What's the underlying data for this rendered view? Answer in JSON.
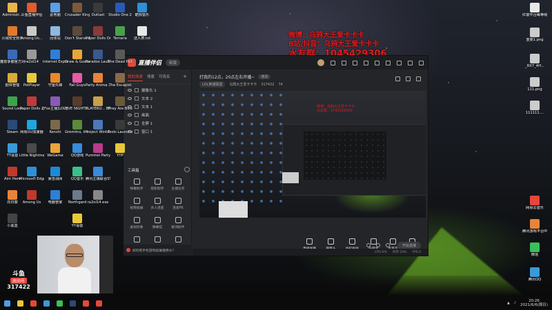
{
  "desktop": {
    "left_icons": [
      {
        "label": "Administr...",
        "color": "#e8b74a"
      },
      {
        "label": "斗鱼直播伴侣",
        "color": "#e25b2b"
      },
      {
        "label": "此电脑",
        "color": "#5aa0e8"
      },
      {
        "label": "火绒安全软件",
        "color": "#e07a2a"
      },
      {
        "label": "Among.Us...",
        "color": "#c9c9c9"
      },
      {
        "label": "回收站",
        "color": "#8fb8e0"
      },
      {
        "label": "魔兽争霸官方对战平台",
        "color": "#3a6ab8"
      },
      {
        "label": "ra2ol14",
        "color": "#999999"
      },
      {
        "label": "Internet Explorer",
        "color": "#2f7fd6"
      },
      {
        "label": "欧体管理",
        "color": "#d9a93a"
      },
      {
        "label": "PotPlayer",
        "color": "#e8c83a"
      },
      {
        "label": "守望先锋",
        "color": "#e88a2a"
      },
      {
        "label": "Sound Lock",
        "color": "#3fa34a"
      },
      {
        "label": "Paper Dolls 2",
        "color": "#c03a3a"
      },
      {
        "label": "[Fox主播]LOL客户端",
        "color": "#8a5ab8"
      },
      {
        "label": "Steam",
        "color": "#2a4a78"
      },
      {
        "label": "网易UU加速器",
        "color": "#1ea5e0"
      },
      {
        "label": "Kenshi",
        "color": "#7a6a4a"
      },
      {
        "label": "TT语音",
        "color": "#3a9ad8"
      },
      {
        "label": "Little Nightmares",
        "color": "#4a4a4a"
      },
      {
        "label": "WeGame",
        "color": "#e8a53a"
      },
      {
        "label": "Aim Hero",
        "color": "#c0392b"
      },
      {
        "label": "Microsoft Edge",
        "color": "#2f8fd6"
      },
      {
        "label": "暴雪战网",
        "color": "#1c8ad8"
      },
      {
        "label": "向日葵",
        "color": "#e8843a"
      },
      {
        "label": "Among Us",
        "color": "#c0392b"
      },
      {
        "label": "电脑管家",
        "color": "#2f7fd6"
      },
      {
        "label": "小黑盒",
        "color": "#444444"
      }
    ],
    "col3_icons": [
      {
        "label": "Crusader Kings III",
        "color": "#7a5a3a"
      },
      {
        "label": "Don't Starve Together",
        "color": "#5a4a3a"
      },
      {
        "label": "Draw & Guess",
        "color": "#e8a53a"
      },
      {
        "label": "Fall Guys",
        "color": "#e85aa5"
      },
      {
        "label": "FIVE NIGHTS...",
        "color": "#5a3a2a"
      },
      {
        "label": "Gremlins, Inc.",
        "color": "#5a8a3a"
      },
      {
        "label": "QQ游戏",
        "color": "#3a8ad8"
      },
      {
        "label": "QQ音乐",
        "color": "#3ac08a"
      },
      {
        "label": "Northgard",
        "color": "#6a7a8a"
      },
      {
        "label": "YY语音",
        "color": "#e8c83a"
      }
    ],
    "col4_icons": [
      {
        "label": "Outlast",
        "color": "#3a3a3a"
      },
      {
        "label": "Paper Dolls Original",
        "color": "#8a3a3a"
      },
      {
        "label": "Paradox Launcher v2",
        "color": "#3a5a8a"
      },
      {
        "label": "Party Anima...",
        "color": "#e8843a"
      },
      {
        "label": "PLAYERU... BATTLEGR...",
        "color": "#c8a04a"
      },
      {
        "label": "Project Winter",
        "color": "#4a7ab8"
      },
      {
        "label": "Pummel Party",
        "color": "#b83a8a"
      },
      {
        "label": "腾讯主播联合STG",
        "color": "#3a8ad8"
      },
      {
        "label": "ra2ol14.exe",
        "color": "#888888"
      }
    ],
    "col5_icons": [
      {
        "label": "Studio One 2",
        "color": "#2a5ab8"
      },
      {
        "label": "Terraria",
        "color": "#4aa04a"
      },
      {
        "label": "The Dead Picture",
        "color": "#5a5a5a"
      },
      {
        "label": "The Escapist",
        "color": "#8a6a4a"
      },
      {
        "label": "They Are Billions",
        "color": "#6a5a3a"
      },
      {
        "label": "Tools Launcher",
        "color": "#3a3a3a"
      },
      {
        "label": "YYP",
        "color": "#e8c83a"
      }
    ],
    "col6_icons": [
      {
        "label": "酷狗音乐",
        "color": "#2f8fd6"
      },
      {
        "label": "送人表.txt",
        "color": "#e8e8e8"
      }
    ],
    "right_icons": [
      {
        "label": "红警平台每等级别.txt",
        "color": "#e8e8e8"
      },
      {
        "label": "重要1.png",
        "color": "#cccccc"
      },
      {
        "label": "_RX7_4H...",
        "color": "#cccccc"
      },
      {
        "label": "111.png",
        "color": "#cccccc"
      },
      {
        "label": "111111....",
        "color": "#cccccc"
      },
      {
        "label": "网易云音乐",
        "color": "#e8463b"
      },
      {
        "label": "腾讯游戏平台中心",
        "color": "#e8843a"
      },
      {
        "label": "微信",
        "color": "#3ac05a"
      },
      {
        "label": "腾讯QQ",
        "color": "#3a9ad8"
      }
    ]
  },
  "overlay": {
    "line1": "微博：乌鸦大王爱卡卡卡",
    "line2": "B站/抖音：乌鸦大王爱卡卡卡",
    "line3": "水友群：1045429306"
  },
  "app": {
    "brand": "直播伴侣",
    "version": "新版",
    "tabs": [
      "我的场景",
      "场景",
      "可改名"
    ],
    "sources": [
      "摄像头 1",
      "文本 2",
      "文本 1",
      "画面",
      "全屏 1",
      "窗口 1"
    ],
    "tools_title": "工具箱",
    "tools": [
      "弹幕助手",
      "观影助手",
      "主播任务",
      "视频投屏",
      "多人连麦",
      "连麦PK",
      "虚拟形象",
      "弹幕馆",
      "歌词助手",
      "连麦",
      "投票",
      "更多"
    ],
    "headline": "打我的12点，20点左右开播~",
    "headline_tag": "修改",
    "subline": {
      "category": "LOL英雄联盟",
      "owner": "乌鸦大王爱卡卡卡",
      "room_id": "317422",
      "likes": "74"
    },
    "preview_red": "微博：乌鸦大王爱卡卡卡\n水友群：1045429306",
    "controls": [
      "直播屏幕",
      "摄像头",
      "手机投屏",
      "多媒体",
      "麦克风",
      "扬声器"
    ],
    "start_button": "开始直播",
    "status": [
      "CPU:0%",
      "内存:14%",
      "FPS:0"
    ],
    "tip": "如何把手机游戏投屏摄像头？"
  },
  "room": {
    "logo": "斗鱼",
    "label": "房间号",
    "number": "317422"
  },
  "taskbar": {
    "icons": [
      {
        "name": "windows",
        "color": "#4aa0e8"
      },
      {
        "name": "file-explorer",
        "color": "#e8c83a"
      },
      {
        "name": "chrome",
        "color": "#e8463b"
      },
      {
        "name": "qq",
        "color": "#3a9ad8"
      },
      {
        "name": "wechat",
        "color": "#3ac05a"
      },
      {
        "name": "steam",
        "color": "#2a4a78"
      },
      {
        "name": "live-companion",
        "color": "#e8463b"
      },
      {
        "name": "netease-music",
        "color": "#e8463b"
      }
    ],
    "time": "20:26",
    "date": "2021/6/6(周日)"
  }
}
